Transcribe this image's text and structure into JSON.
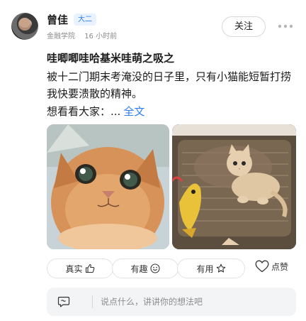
{
  "author": {
    "name": "曾佳",
    "badge": "大二",
    "school": "金融学院",
    "time": "16 小时前"
  },
  "header": {
    "follow_label": "关注",
    "more_icon": "more-dots-icon"
  },
  "post": {
    "title": "哇唧唧哇哈基米哇萌之吸之",
    "body": "被十二门期末考淹没的日子里，只有小猫能短暂打捞我快要溃散的精神。",
    "more_prefix": "想看看大家：...",
    "more_link": "全文"
  },
  "photos": [
    {
      "subject": "orange-kitten-closeup"
    },
    {
      "subject": "kitten-on-scratcher"
    }
  ],
  "actions": {
    "real_label": "真实",
    "real_icon": "thumbs-up-icon",
    "fun_label": "有趣",
    "fun_icon": "smiley-icon",
    "useful_label": "有用",
    "useful_icon": "star-icon",
    "like_label": "点赞",
    "like_icon": "heart-icon"
  },
  "comment": {
    "placeholder": "说点什么，讲讲你的想法吧",
    "icon": "comment-bubble-icon"
  },
  "colors": {
    "accent": "#2e7cf6",
    "badge_bg": "#e9f2ff"
  }
}
